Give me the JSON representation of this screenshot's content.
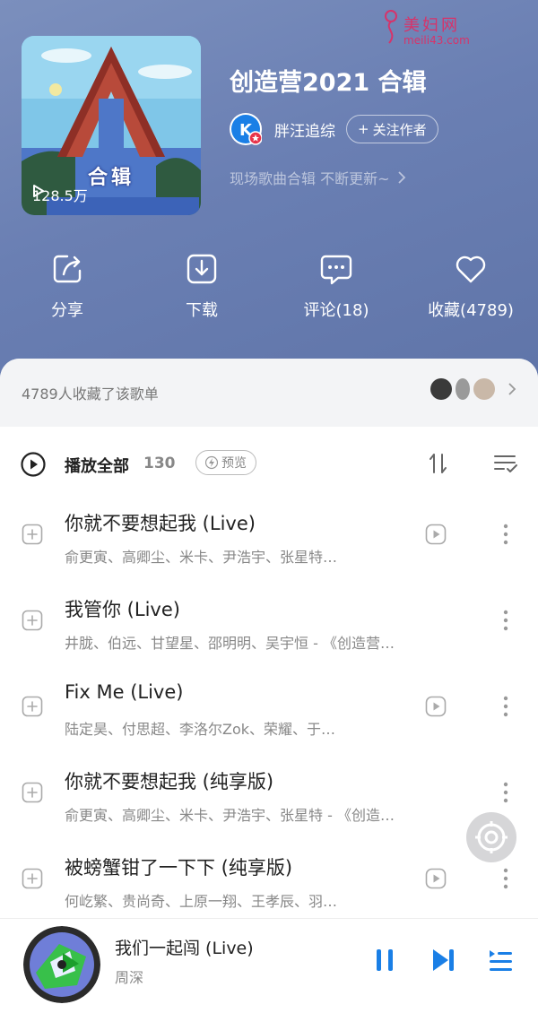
{
  "watermark": {
    "title": "美妇网",
    "url": "meili43.com"
  },
  "playlist": {
    "cover_label": "合辑",
    "play_count": "128.5万",
    "title": "创造营2021 合辑",
    "author": "胖汪追综",
    "follow_label": "关注作者",
    "description": "现场歌曲合辑 不断更新~"
  },
  "actions": {
    "share": "分享",
    "download": "下载",
    "comment": "评论(18)",
    "favorite": "收藏(4789)"
  },
  "collect_bar": {
    "text": "4789人收藏了该歌单"
  },
  "play_all": {
    "label": "播放全部",
    "count": "130",
    "preview_label": "预览"
  },
  "songs": [
    {
      "title": "你就不要想起我 (Live)",
      "artists": "俞更寅、高卿尘、米卡、尹浩宇、张星特…",
      "has_mv": true
    },
    {
      "title": "我管你 (Live)",
      "artists": "井胧、伯远、甘望星、邵明明、吴宇恒 - 《创造营…",
      "has_mv": false
    },
    {
      "title": "Fix Me (Live)",
      "artists": "陆定昊、付思超、李洛尔Zok、荣耀、于…",
      "has_mv": true
    },
    {
      "title": "你就不要想起我 (纯享版)",
      "artists": "俞更寅、高卿尘、米卡、尹浩宇、张星特 - 《创造…",
      "has_mv": false
    },
    {
      "title": "被螃蟹钳了一下下 (纯享版)",
      "artists": "何屹繁、贵尚奇、上原一翔、王孝辰、羽…",
      "has_mv": true
    }
  ],
  "now_playing": {
    "title": "我们一起闯 (Live)",
    "artist": "周深"
  },
  "colors": {
    "accent": "#1a7fe6",
    "hero": "#6a7fb3"
  }
}
